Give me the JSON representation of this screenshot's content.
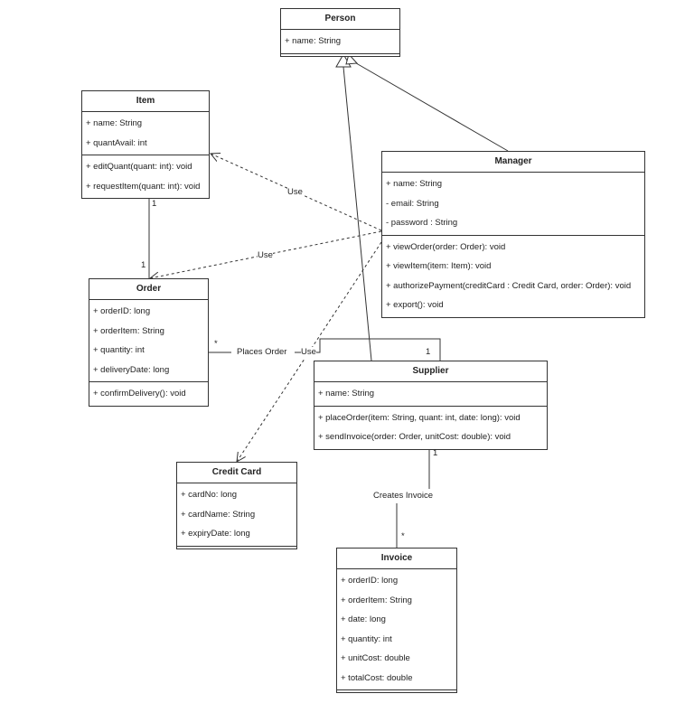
{
  "classes": {
    "person": {
      "name": "Person",
      "attributes": [
        "+ name: String"
      ],
      "methods": []
    },
    "item": {
      "name": "Item",
      "attributes": [
        "+ name: String",
        "+ quantAvail: int"
      ],
      "methods": [
        "+ editQuant(quant: int): void",
        "+ requestItem(quant: int): void"
      ]
    },
    "manager": {
      "name": "Manager",
      "attributes": [
        "+ name: String",
        "- email: String",
        "- password : String"
      ],
      "methods": [
        "+ viewOrder(order: Order): void",
        "+ viewItem(item: Item): void",
        "+ authorizePayment(creditCard : Credit Card, order: Order): void",
        "+ export(): void"
      ]
    },
    "order": {
      "name": "Order",
      "attributes": [
        "+ orderID: long",
        "+ orderItem: String",
        "+ quantity: int",
        "+ deliveryDate: long"
      ],
      "methods": [
        "+ confirmDelivery(): void"
      ]
    },
    "supplier": {
      "name": "Supplier",
      "attributes": [
        "+ name: String"
      ],
      "methods": [
        "+ placeOrder(item: String, quant: int, date: long): void",
        "+ sendInvoice(order: Order, unitCost: double): void"
      ]
    },
    "credit_card": {
      "name": "Credit Card",
      "attributes": [
        "+ cardNo: long",
        "+ cardName: String",
        "+ expiryDate: long"
      ],
      "methods": []
    },
    "invoice": {
      "name": "Invoice",
      "attributes": [
        "+ orderID: long",
        "+ orderItem: String",
        "+ date: long",
        "+ quantity: int",
        "+ unitCost: double",
        "+ totalCost: double"
      ],
      "methods": []
    }
  },
  "relationships": {
    "manager_uses_item": "Use",
    "manager_uses_order": "Use",
    "manager_uses_credit_card": "Use",
    "item_order_mult_item": "1",
    "item_order_mult_order": "1",
    "places_order": "Places Order",
    "places_order_mult_order": "*",
    "places_order_mult_supplier": "1",
    "creates_invoice": "Creates Invoice",
    "creates_invoice_mult_supplier": "1",
    "creates_invoice_mult_invoice": "*"
  }
}
